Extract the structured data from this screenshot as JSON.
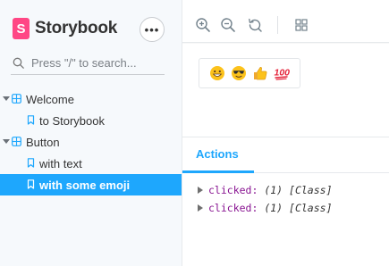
{
  "sidebar": {
    "brand": {
      "logo_letter": "S",
      "name": "Storybook"
    },
    "menu_button": "•••",
    "search": {
      "placeholder": "Press \"/\" to search..."
    },
    "tree": [
      {
        "type": "group",
        "label": "Welcome",
        "icon": "component-icon"
      },
      {
        "type": "story",
        "label": "to Storybook",
        "icon": "bookmark-icon"
      },
      {
        "type": "group",
        "label": "Button",
        "icon": "component-icon"
      },
      {
        "type": "story",
        "label": "with text",
        "icon": "bookmark-icon"
      },
      {
        "type": "story",
        "label": "with some emoji",
        "icon": "bookmark-icon",
        "selected": true
      }
    ]
  },
  "toolbar": {
    "tools": [
      "zoom-in-icon",
      "zoom-out-icon",
      "reset-zoom-icon",
      "grid-icon"
    ]
  },
  "preview": {
    "button_emojis": [
      "grinning-face",
      "sunglasses-face",
      "thumbs-up",
      "hundred-points"
    ]
  },
  "addons": {
    "tabs": [
      {
        "label": "Actions",
        "active": true
      }
    ],
    "actions_log": [
      {
        "name": "clicked:",
        "args": "(1) [Class]"
      },
      {
        "name": "clicked:",
        "args": "(1) [Class]"
      }
    ]
  },
  "colors": {
    "accent": "#1ea7fd",
    "brand": "#ff4785",
    "sidebar_bg": "#f6f9fc"
  }
}
